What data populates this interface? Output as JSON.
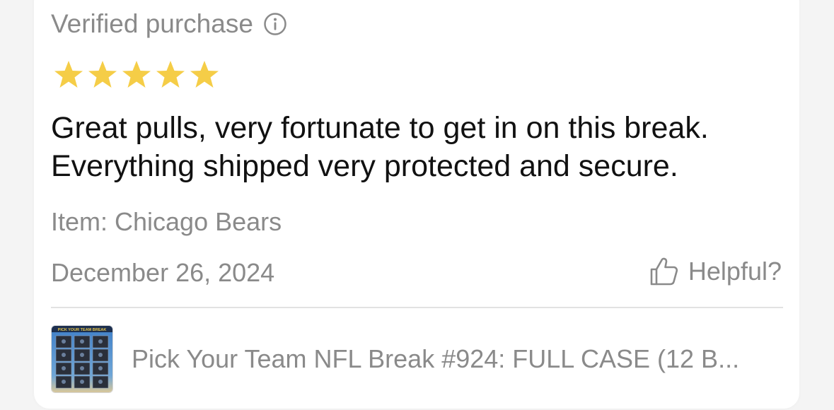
{
  "review": {
    "verified_label": "Verified purchase",
    "rating": 5,
    "rating_max": 5,
    "star_color": "#f5cd47",
    "body_lines": [
      "Great pulls, very fortunate to get in on this break.",
      "Everything shipped very protected and secure."
    ],
    "item_label": "Item: Chicago Bears",
    "date": "December 26, 2024",
    "helpful_label": "Helpful?"
  },
  "product": {
    "title": "Pick Your Team NFL Break #924: FULL CASE (12 B...",
    "thumbnail_caption": "PICK YOUR TEAM BREAK"
  },
  "colors": {
    "secondary_text": "#8a8a8a",
    "primary_text": "#111111",
    "divider": "#e2e2e2",
    "card_background": "#ffffff"
  },
  "icons": {
    "verified_info": "info-icon",
    "helpful": "thumbs-up-icon",
    "rating": "star-icon"
  }
}
